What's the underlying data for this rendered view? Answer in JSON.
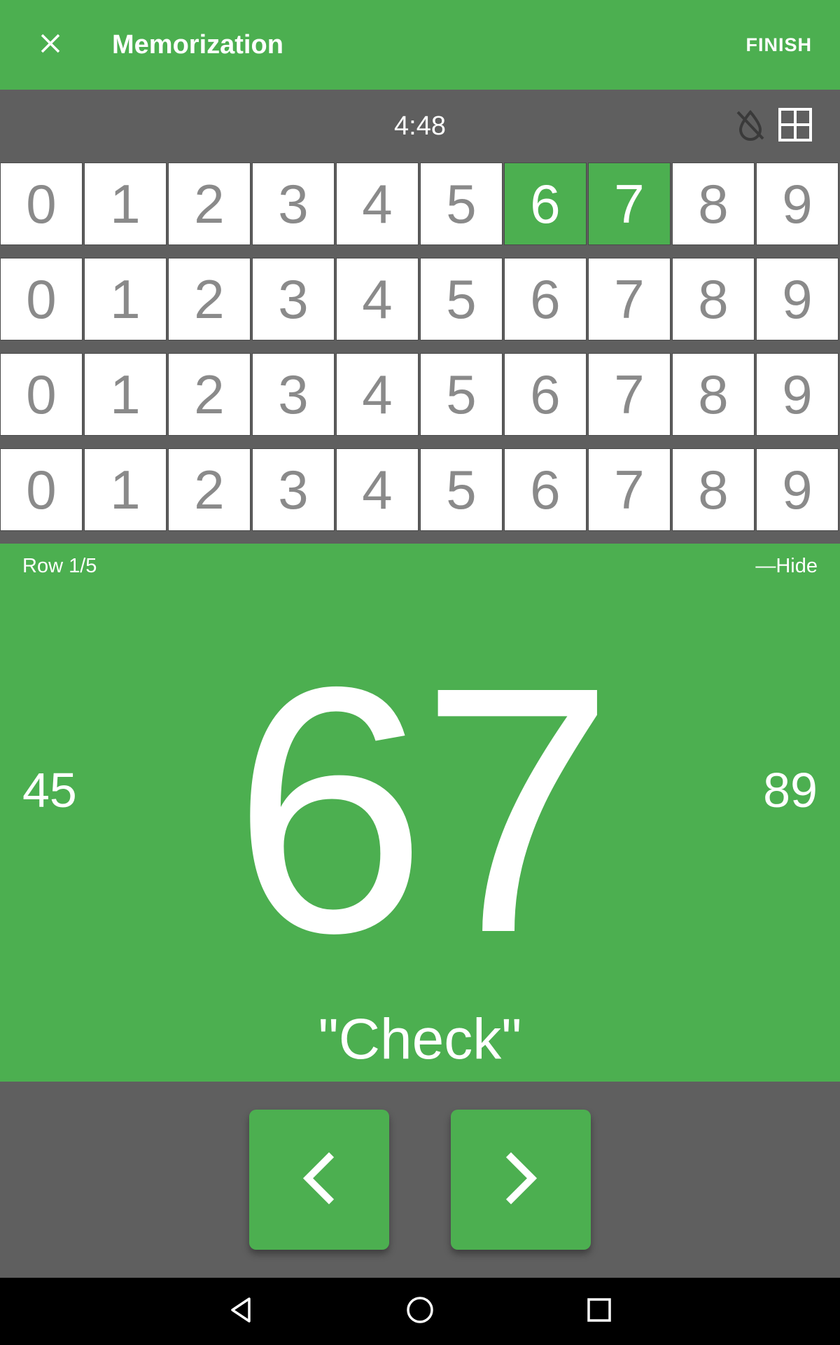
{
  "app_bar": {
    "title": "Memorization",
    "finish_label": "FINISH",
    "close_icon": "close-icon"
  },
  "timer_bar": {
    "time": "4:48",
    "icons": [
      "visibility-off-icon",
      "grid-icon"
    ]
  },
  "digit_grid": {
    "rows": [
      {
        "digits": [
          "0",
          "1",
          "2",
          "3",
          "4",
          "5",
          "6",
          "7",
          "8",
          "9"
        ],
        "highlighted": [
          "6",
          "7"
        ]
      },
      {
        "digits": [
          "0",
          "1",
          "2",
          "3",
          "4",
          "5",
          "6",
          "7",
          "8",
          "9"
        ],
        "highlighted": []
      },
      {
        "digits": [
          "0",
          "1",
          "2",
          "3",
          "4",
          "5",
          "6",
          "7",
          "8",
          "9"
        ],
        "highlighted": []
      },
      {
        "digits": [
          "0",
          "1",
          "2",
          "3",
          "4",
          "5",
          "6",
          "7",
          "8",
          "9"
        ],
        "highlighted": []
      }
    ]
  },
  "display": {
    "row_label": "Row 1/5",
    "hide_label": "—Hide",
    "previous": "45",
    "current": "67",
    "next": "89",
    "word": "\"Check\""
  },
  "nav_buttons": {
    "prev_icon": "chevron-left-icon",
    "next_icon": "chevron-right-icon"
  },
  "system_nav": {
    "icons": [
      "back-icon",
      "home-icon",
      "recents-icon"
    ]
  },
  "colors": {
    "accent": "#4caf50",
    "background": "#5f5f5f",
    "cell": "#ffffff",
    "cell_text": "#8a8a8a"
  }
}
